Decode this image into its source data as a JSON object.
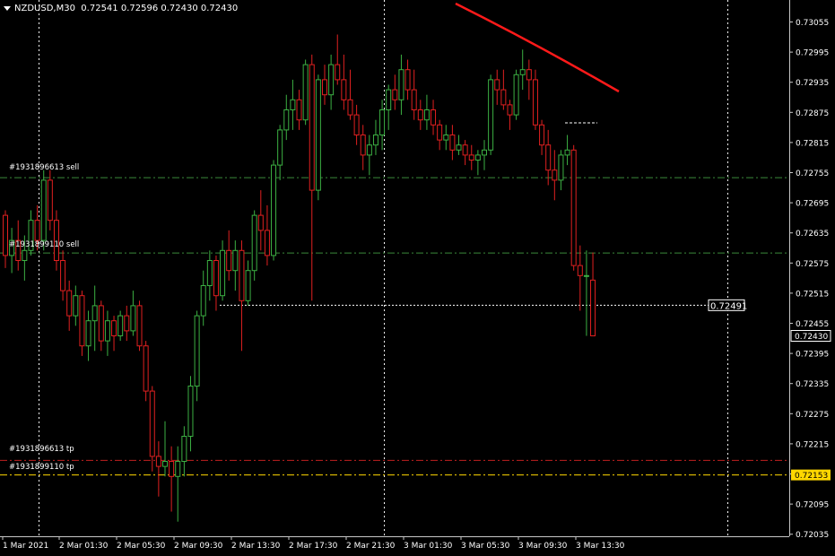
{
  "header": {
    "symbol": "NZDUSD,M30",
    "ohlc": "0.72541 0.72596 0.72430 0.72430"
  },
  "price_axis": {
    "labels": [
      "0.73055",
      "0.72995",
      "0.72935",
      "0.72875",
      "0.72815",
      "0.72755",
      "0.72695",
      "0.72635",
      "0.72575",
      "0.72515",
      "0.72455",
      "0.72395",
      "0.72335",
      "0.72275",
      "0.72215",
      "0.72155",
      "0.72095",
      "0.72035"
    ],
    "current_price": "0.72430",
    "tp_price": "0.72153"
  },
  "time_axis": {
    "labels": [
      "1 Mar 2021",
      "2 Mar 01:30",
      "2 Mar 05:30",
      "2 Mar 09:30",
      "2 Mar 13:30",
      "2 Mar 17:30",
      "2 Mar 21:30",
      "3 Mar 01:30",
      "3 Mar 05:30",
      "3 Mar 09:30",
      "3 Mar 13:30"
    ]
  },
  "orders": {
    "sell1": "#1931896613 sell",
    "sell2": "#1931899110 sell",
    "tp1": "#1931896613 tp",
    "tp2": "#1931899110 tp"
  },
  "price_marker": "0.72491",
  "colors": {
    "background": "#000000",
    "bull": "#3cb043",
    "bear": "#e02020",
    "order_line": "#3a8a3a",
    "tp_line": "#c02020",
    "tp_tag": "#ffd700",
    "trendline": "#ff1a1a",
    "grid": "#ffffff"
  },
  "chart_data": {
    "type": "candlestick",
    "candles": [
      [
        0.7267,
        0.7268,
        0.72565,
        0.7259
      ],
      [
        0.7259,
        0.72645,
        0.72555,
        0.7262
      ],
      [
        0.7262,
        0.7266,
        0.7256,
        0.7258
      ],
      [
        0.7258,
        0.7263,
        0.7254,
        0.726
      ],
      [
        0.726,
        0.7268,
        0.7259,
        0.7266
      ],
      [
        0.7266,
        0.7269,
        0.726,
        0.7262
      ],
      [
        0.7262,
        0.7276,
        0.726,
        0.7274
      ],
      [
        0.7274,
        0.7276,
        0.7264,
        0.7266
      ],
      [
        0.7266,
        0.7268,
        0.7256,
        0.7258
      ],
      [
        0.7258,
        0.726,
        0.725,
        0.7252
      ],
      [
        0.7252,
        0.7254,
        0.7244,
        0.7247
      ],
      [
        0.7247,
        0.7253,
        0.7245,
        0.7251
      ],
      [
        0.7251,
        0.7252,
        0.7239,
        0.7241
      ],
      [
        0.7241,
        0.7248,
        0.7238,
        0.7246
      ],
      [
        0.7246,
        0.7253,
        0.724,
        0.7249
      ],
      [
        0.7249,
        0.725,
        0.724,
        0.7242
      ],
      [
        0.7242,
        0.7248,
        0.7239,
        0.7246
      ],
      [
        0.7246,
        0.7247,
        0.724,
        0.7243
      ],
      [
        0.7243,
        0.7248,
        0.7242,
        0.7247
      ],
      [
        0.7247,
        0.7249,
        0.7242,
        0.7244
      ],
      [
        0.7244,
        0.7252,
        0.7243,
        0.7249
      ],
      [
        0.7249,
        0.725,
        0.724,
        0.7241
      ],
      [
        0.7241,
        0.7242,
        0.723,
        0.7232
      ],
      [
        0.7232,
        0.7233,
        0.7216,
        0.7219
      ],
      [
        0.7219,
        0.7222,
        0.7211,
        0.7217
      ],
      [
        0.7217,
        0.7226,
        0.7215,
        0.7218
      ],
      [
        0.7218,
        0.7221,
        0.7208,
        0.7215
      ],
      [
        0.7215,
        0.7221,
        0.7206,
        0.7218
      ],
      [
        0.7218,
        0.7225,
        0.7215,
        0.7223
      ],
      [
        0.7223,
        0.7235,
        0.722,
        0.7233
      ],
      [
        0.7233,
        0.7248,
        0.723,
        0.7247
      ],
      [
        0.7247,
        0.7256,
        0.7245,
        0.7253
      ],
      [
        0.7253,
        0.726,
        0.725,
        0.7258
      ],
      [
        0.7258,
        0.7259,
        0.7248,
        0.7251
      ],
      [
        0.7251,
        0.7262,
        0.725,
        0.726
      ],
      [
        0.726,
        0.7264,
        0.7254,
        0.7256
      ],
      [
        0.7256,
        0.7262,
        0.7252,
        0.726
      ],
      [
        0.726,
        0.7262,
        0.724,
        0.725
      ],
      [
        0.725,
        0.7258,
        0.7249,
        0.7256
      ],
      [
        0.7256,
        0.7268,
        0.7254,
        0.7267
      ],
      [
        0.7267,
        0.7272,
        0.726,
        0.7264
      ],
      [
        0.7264,
        0.7269,
        0.7257,
        0.7259
      ],
      [
        0.7259,
        0.7278,
        0.7258,
        0.7277
      ],
      [
        0.7277,
        0.7285,
        0.7274,
        0.7284
      ],
      [
        0.7284,
        0.7291,
        0.7282,
        0.7288
      ],
      [
        0.7288,
        0.7294,
        0.7284,
        0.729
      ],
      [
        0.729,
        0.7292,
        0.7284,
        0.7286
      ],
      [
        0.7286,
        0.7298,
        0.7285,
        0.7297
      ],
      [
        0.7297,
        0.7299,
        0.725,
        0.7272
      ],
      [
        0.7272,
        0.7295,
        0.727,
        0.7294
      ],
      [
        0.7294,
        0.7297,
        0.7289,
        0.7291
      ],
      [
        0.7291,
        0.7299,
        0.7288,
        0.7297
      ],
      [
        0.7297,
        0.7303,
        0.7293,
        0.7294
      ],
      [
        0.7294,
        0.7299,
        0.7288,
        0.729
      ],
      [
        0.729,
        0.7296,
        0.7286,
        0.7287
      ],
      [
        0.7287,
        0.7289,
        0.7281,
        0.7283
      ],
      [
        0.7283,
        0.7285,
        0.7276,
        0.7279
      ],
      [
        0.7279,
        0.7283,
        0.7275,
        0.7281
      ],
      [
        0.7281,
        0.7286,
        0.7279,
        0.7283
      ],
      [
        0.7283,
        0.729,
        0.728,
        0.7288
      ],
      [
        0.7288,
        0.7293,
        0.7284,
        0.7292
      ],
      [
        0.7292,
        0.7295,
        0.7288,
        0.729
      ],
      [
        0.729,
        0.7299,
        0.7287,
        0.7296
      ],
      [
        0.7296,
        0.7298,
        0.729,
        0.7292
      ],
      [
        0.7292,
        0.7296,
        0.7286,
        0.7288
      ],
      [
        0.7288,
        0.729,
        0.7284,
        0.7286
      ],
      [
        0.7286,
        0.7291,
        0.7284,
        0.7288
      ],
      [
        0.7288,
        0.729,
        0.7283,
        0.7285
      ],
      [
        0.7285,
        0.7286,
        0.728,
        0.7282
      ],
      [
        0.7282,
        0.7285,
        0.728,
        0.7283
      ],
      [
        0.7283,
        0.7285,
        0.7278,
        0.728
      ],
      [
        0.728,
        0.7283,
        0.7279,
        0.7281
      ],
      [
        0.7281,
        0.7282,
        0.7277,
        0.7279
      ],
      [
        0.7279,
        0.7281,
        0.7276,
        0.7278
      ],
      [
        0.7278,
        0.728,
        0.7275,
        0.7279
      ],
      [
        0.7279,
        0.7282,
        0.7276,
        0.728
      ],
      [
        0.728,
        0.7295,
        0.7279,
        0.7294
      ],
      [
        0.7294,
        0.7296,
        0.7289,
        0.7292
      ],
      [
        0.7292,
        0.7296,
        0.7288,
        0.7289
      ],
      [
        0.7289,
        0.729,
        0.7284,
        0.7287
      ],
      [
        0.7287,
        0.7296,
        0.7286,
        0.7295
      ],
      [
        0.7295,
        0.73,
        0.7292,
        0.7296
      ],
      [
        0.7296,
        0.7298,
        0.729,
        0.7294
      ],
      [
        0.7294,
        0.7296,
        0.7284,
        0.7285
      ],
      [
        0.7285,
        0.7286,
        0.7279,
        0.7281
      ],
      [
        0.7281,
        0.7284,
        0.7273,
        0.7276
      ],
      [
        0.7276,
        0.728,
        0.727,
        0.7274
      ],
      [
        0.7274,
        0.728,
        0.7272,
        0.7279
      ],
      [
        0.7279,
        0.7283,
        0.7277,
        0.728
      ],
      [
        0.728,
        0.7281,
        0.7256,
        0.7257
      ],
      [
        0.7257,
        0.7261,
        0.7248,
        0.7255
      ],
      [
        0.7255,
        0.726,
        0.7243,
        0.7255
      ],
      [
        0.72541,
        0.72596,
        0.7243,
        0.7243
      ]
    ]
  }
}
